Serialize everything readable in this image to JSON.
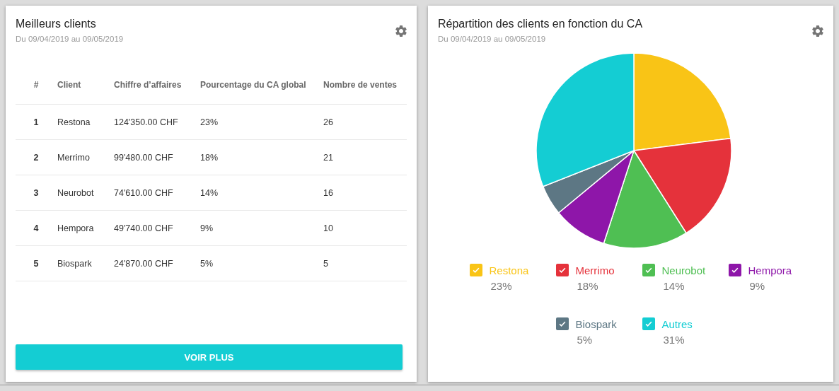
{
  "cards": [
    {
      "title": "Meilleurs clients",
      "subtitle": "Du 09/04/2019 au 09/05/2019",
      "table": {
        "columns": [
          "#",
          "Client",
          "Chiffre d’affaires",
          "Pourcentage du CA global",
          "Nombre de ventes"
        ],
        "rows": [
          [
            "1",
            "Restona",
            "124'350.00 CHF",
            "23%",
            "26"
          ],
          [
            "2",
            "Merrimo",
            "99'480.00 CHF",
            "18%",
            "21"
          ],
          [
            "3",
            "Neurobot",
            "74'610.00 CHF",
            "14%",
            "16"
          ],
          [
            "4",
            "Hempora",
            "49'740.00 CHF",
            "9%",
            "10"
          ],
          [
            "5",
            "Biospark",
            "24'870.00 CHF",
            "5%",
            "5"
          ]
        ]
      },
      "button": "VOIR PLUS"
    },
    {
      "title": "Répartition des clients en fonction du CA",
      "subtitle": "Du 09/04/2019 au 09/05/2019",
      "chart_data": {
        "type": "pie",
        "categories": [
          "Restona",
          "Merrimo",
          "Neurobot",
          "Hempora",
          "Biospark",
          "Autres"
        ],
        "series": [
          {
            "values": [
              23,
              18,
              14,
              9,
              5,
              31
            ]
          }
        ],
        "colors": [
          "#f9c416",
          "#e5323b",
          "#4fbf53",
          "#8e16a9",
          "#5d7784",
          "#14cdd3"
        ]
      },
      "legend": [
        {
          "value": "23%",
          "color": "#f9c416",
          "checked": true
        },
        {
          "value": "18%",
          "color": "#e5323b",
          "checked": true
        },
        {
          "value": "14%",
          "color": "#4fbf53",
          "checked": true
        },
        {
          "value": "9%",
          "color": "#8e16a9",
          "checked": true
        },
        {
          "value": "5%",
          "color": "#5d7784",
          "checked": true
        },
        {
          "value": "31%",
          "color": "#14cdd3",
          "checked": true
        }
      ]
    }
  ]
}
